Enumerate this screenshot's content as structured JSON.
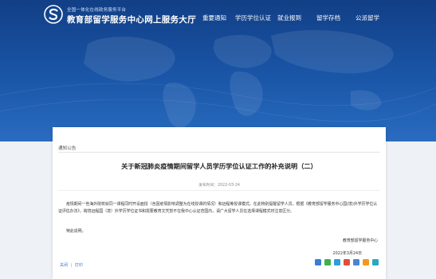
{
  "header": {
    "logo_small": "全国一体化在线政务服务平台",
    "logo_title": "教育部留学服务中心网上服务大厅",
    "nav": [
      "重要通知",
      "学历学位认证",
      "就业报到",
      "留学存档",
      "公派留学"
    ]
  },
  "article": {
    "breadcrumb": "通知公告",
    "title": "关于新冠肺炎疫情期间留学人员学历学位认证工作的补充说明（二）",
    "meta": "发布时间：2022-03-24",
    "paragraph": "疫情期间一些海外院校就同一课程同时开设面授（含因疫情影响调整为在线授课的情况）和远程等授课模式。在此特别提醒留学人员，根据《教育部留学服务中心国(境)外学历学位认证评估办法》，跨境远程国（境）外学历学位证书和需要教育文凭暂不在我中心认证范围内，请广大留学人员在选择课程模式时注意区分。",
    "closing": "特此说明。",
    "signer": "教育部留学服务中心",
    "date": "2022年3月24日",
    "links": [
      "关闭",
      "打印"
    ]
  },
  "colors": {
    "header_blue": "#1a56a8",
    "share_icons": [
      "#3a7dd8",
      "#3fb04a",
      "#2a9fd8",
      "#e14d3b",
      "#4a86d4",
      "#f29a1d",
      "#2aa6c7"
    ]
  }
}
